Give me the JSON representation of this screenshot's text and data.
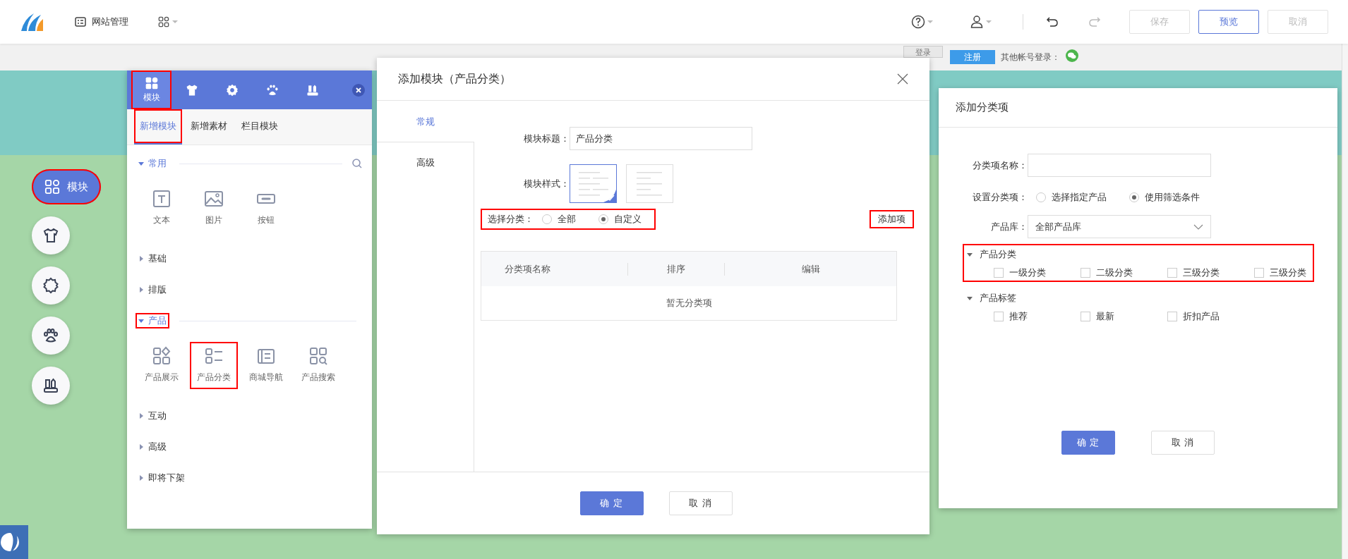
{
  "toolbar": {
    "site_menu": "网站管理",
    "buttons": [
      {
        "label": "保存",
        "kind": "default",
        "disabled": true
      },
      {
        "label": "预览",
        "kind": "outline",
        "disabled": false
      },
      {
        "label": "取消",
        "kind": "default",
        "disabled": true
      }
    ]
  },
  "login_bar": {
    "login": "登录",
    "register": "注册",
    "other_login": "其他帐号登录："
  },
  "float_menu": [
    {
      "kind": "grid",
      "label": "模块",
      "selected": true,
      "highlighted": true
    },
    {
      "kind": "shirt",
      "selected": false,
      "highlighted": false
    },
    {
      "kind": "gear",
      "selected": false,
      "highlighted": false
    },
    {
      "kind": "paw",
      "selected": false,
      "highlighted": false
    },
    {
      "kind": "tower",
      "selected": false,
      "highlighted": false
    }
  ],
  "module_panel": {
    "tabs": [
      {
        "kind": "grid",
        "label": "模块",
        "selected": true
      },
      {
        "kind": "shirt",
        "selected": false
      },
      {
        "kind": "gear",
        "selected": false
      },
      {
        "kind": "paw",
        "selected": false
      },
      {
        "kind": "tower",
        "selected": false
      }
    ],
    "subtabs": [
      {
        "label": "新增模块",
        "selected": true,
        "highlighted": true
      },
      {
        "label": "新增素材",
        "selected": false,
        "highlighted": false
      },
      {
        "label": "栏目模块",
        "selected": false,
        "highlighted": false
      }
    ],
    "sections": [
      {
        "title": "常用",
        "expanded": true,
        "highlighted": false,
        "searchable": true,
        "items": [
          {
            "kind": "text",
            "label": "文本",
            "highlighted": false
          },
          {
            "kind": "image",
            "label": "图片",
            "highlighted": false
          },
          {
            "kind": "button",
            "label": "按钮",
            "highlighted": false
          }
        ]
      },
      {
        "title": "基础",
        "expanded": false,
        "highlighted": false,
        "searchable": false
      },
      {
        "title": "排版",
        "expanded": false,
        "highlighted": false,
        "searchable": false
      },
      {
        "title": "产品",
        "expanded": true,
        "highlighted": true,
        "searchable": false,
        "items": [
          {
            "kind": "showcase",
            "label": "产品展示",
            "highlighted": false
          },
          {
            "kind": "category",
            "label": "产品分类",
            "highlighted": true
          },
          {
            "kind": "nav",
            "label": "商城导航",
            "highlighted": false
          },
          {
            "kind": "search",
            "label": "产品搜索",
            "highlighted": false
          }
        ]
      },
      {
        "title": "互动",
        "expanded": false,
        "highlighted": false,
        "searchable": false
      },
      {
        "title": "高级",
        "expanded": false,
        "highlighted": false,
        "searchable": false
      },
      {
        "title": "即将下架",
        "expanded": false,
        "highlighted": false,
        "searchable": false
      }
    ]
  },
  "module_dialog": {
    "title": "添加模块（产品分类）",
    "nav": [
      {
        "label": "常规",
        "selected": true
      },
      {
        "label": "高级",
        "selected": false
      }
    ],
    "title_label": "模块标题：",
    "title_value": "产品分类",
    "style_label": "模块样式：",
    "styles": [
      {
        "selected": true
      },
      {
        "selected": false
      }
    ],
    "category_label": "选择分类：",
    "category_highlighted": true,
    "category_options": [
      {
        "label": "全部",
        "selected": false
      },
      {
        "label": "自定义",
        "selected": true
      }
    ],
    "add_button": {
      "label": "添加项",
      "highlighted": true
    },
    "table": {
      "columns": [
        "分类项名称",
        "排序",
        "编辑"
      ],
      "empty": "暂无分类项"
    },
    "buttons": [
      {
        "label": "确 定",
        "kind": "primary"
      },
      {
        "label": "取 消",
        "kind": "default"
      }
    ]
  },
  "item_dialog": {
    "title": "添加分类项",
    "name_label": "分类项名称：",
    "setting_label": "设置分类项：",
    "setting_options": [
      {
        "label": "选择指定产品",
        "selected": false
      },
      {
        "label": "使用筛选条件",
        "selected": true
      }
    ],
    "library_label": "产品库：",
    "library_value": "全部产品库",
    "groups": [
      {
        "title": "产品分类",
        "expanded": true,
        "highlighted": true,
        "options": [
          {
            "label": "一级分类",
            "checked": false
          },
          {
            "label": "二级分类",
            "checked": false
          },
          {
            "label": "三级分类",
            "checked": false
          },
          {
            "label": "三级分类",
            "checked": false
          }
        ]
      },
      {
        "title": "产品标签",
        "expanded": true,
        "highlighted": false,
        "options": [
          {
            "label": "推荐",
            "checked": false
          },
          {
            "label": "最新",
            "checked": false
          },
          {
            "label": "折扣产品",
            "checked": false
          }
        ]
      }
    ],
    "buttons": [
      {
        "label": "确 定",
        "kind": "primary"
      },
      {
        "label": "取 消",
        "kind": "default"
      }
    ]
  }
}
